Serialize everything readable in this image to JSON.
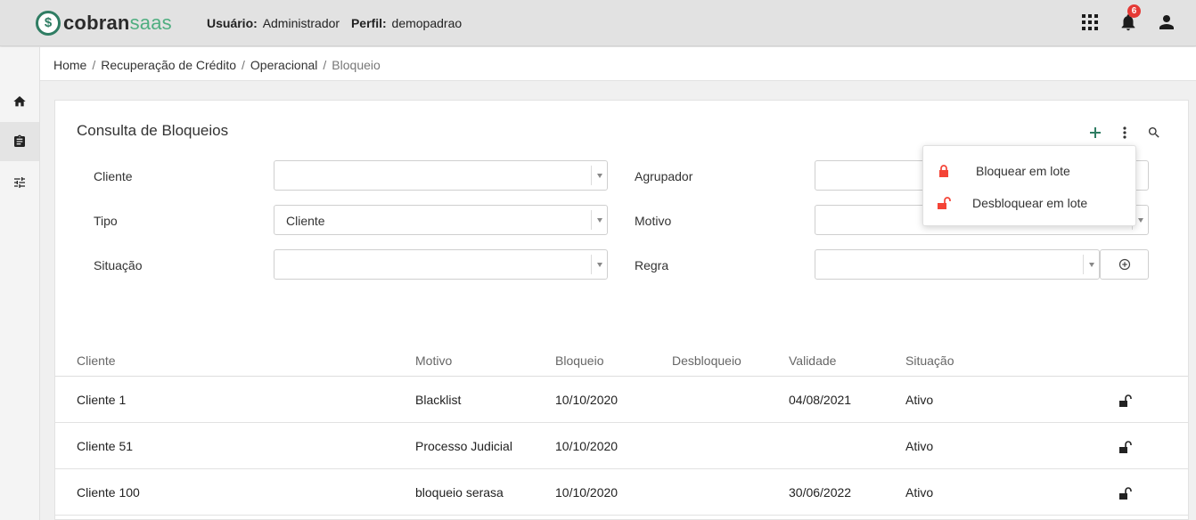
{
  "app": {
    "logo_text_a": "cobran",
    "logo_text_b": "saas",
    "logo_symbol": "$",
    "user_label": "Usuário:",
    "user_value": "Administrador",
    "profile_label": "Perfil:",
    "profile_value": "demopadrao",
    "notifications_count": "6",
    "icons": [
      "apps-grid-icon",
      "bell-icon",
      "account-icon"
    ],
    "brand_color": "#2f7d63"
  },
  "sidebar": {
    "items": [
      {
        "icon": "home-icon",
        "active": false
      },
      {
        "icon": "clipboard-icon",
        "active": true
      },
      {
        "icon": "tune-icon",
        "active": false
      }
    ]
  },
  "breadcrumb": {
    "items": [
      "Home",
      "Recuperação de Crédito",
      "Operacional"
    ],
    "current": "Bloqueio",
    "separator": "/"
  },
  "page": {
    "title": "Consulta de Bloqueios",
    "actions": [
      "add-icon",
      "more-vert-icon",
      "search-icon"
    ]
  },
  "filters": {
    "cliente": {
      "label": "Cliente",
      "value": ""
    },
    "tipo": {
      "label": "Tipo",
      "value": "Cliente"
    },
    "situacao": {
      "label": "Situação",
      "value": ""
    },
    "agrupador": {
      "label": "Agrupador",
      "value": ""
    },
    "motivo": {
      "label": "Motivo",
      "value": ""
    },
    "regra": {
      "label": "Regra",
      "value": ""
    }
  },
  "table": {
    "columns": [
      "Cliente",
      "Motivo",
      "Bloqueio",
      "Desbloqueio",
      "Validade",
      "Situação"
    ],
    "rows": [
      {
        "cliente": "Cliente 1",
        "motivo": "Blacklist",
        "bloqueio": "10/10/2020",
        "desbloqueio": "",
        "validade": "04/08/2021",
        "situacao": "Ativo"
      },
      {
        "cliente": "Cliente 51",
        "motivo": "Processo Judicial",
        "bloqueio": "10/10/2020",
        "desbloqueio": "",
        "validade": "",
        "situacao": "Ativo"
      },
      {
        "cliente": "Cliente 100",
        "motivo": "bloqueio serasa",
        "bloqueio": "10/10/2020",
        "desbloqueio": "",
        "validade": "30/06/2022",
        "situacao": "Ativo"
      }
    ]
  },
  "menu": {
    "items": [
      {
        "label": "Bloquear em lote",
        "icon": "lock-icon"
      },
      {
        "label": "Desbloquear em lote",
        "icon": "lock-open-icon"
      }
    ],
    "icon_color": "#f44336"
  }
}
